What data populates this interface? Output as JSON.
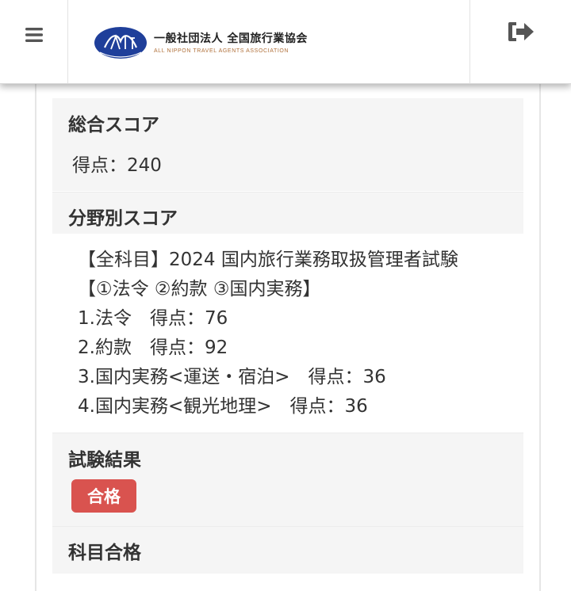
{
  "header": {
    "logo": {
      "title": "一般社団法人 全国旅行業協会",
      "subtitle": "ALL NIPPON TRAVEL AGENTS ASSOCIATION",
      "emblem_text": "ANTA"
    },
    "menu_icon": "hamburger-menu-icon",
    "logout_icon": "sign-out-icon"
  },
  "colors": {
    "logo_blue": "#1f3f9a",
    "badge_red": "#d9534f",
    "section_bg": "#f5f5f5"
  },
  "total_score": {
    "title": "総合スコア",
    "score_text": "得点：240"
  },
  "field_scores": {
    "title": "分野別スコア",
    "lines": [
      "【全科目】2024 国内旅行業務取扱管理者試験",
      "【①法令 ②約款 ③国内実務】",
      "1.法令　得点：76",
      "2.約款　得点：92",
      "3.国内実務<運送・宿泊>　得点：36",
      "4.国内実務<観光地理>　得点：36"
    ]
  },
  "exam_result": {
    "title": "試験結果",
    "badge": "合格"
  },
  "subject_pass": {
    "title": "科目合格"
  }
}
